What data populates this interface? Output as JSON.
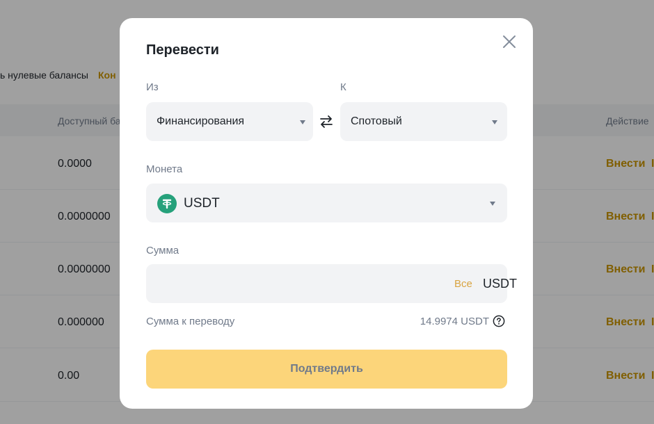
{
  "background": {
    "filter_text": "ь нулевые балансы",
    "filter_link": "Кон",
    "header": {
      "available": "Доступный ба",
      "action": "Действие"
    },
    "rows": [
      {
        "value": "0.0000",
        "action": "Внести",
        "sep": "I"
      },
      {
        "value": "0.0000000",
        "action": "Внести",
        "sep": "I"
      },
      {
        "value": "0.0000000",
        "action": "Внести",
        "sep": "I"
      },
      {
        "value": "0.000000",
        "action": "Внести",
        "sep": "I"
      },
      {
        "value": "0.00",
        "action": "Внести",
        "sep": "I"
      }
    ]
  },
  "modal": {
    "title": "Перевести",
    "close_icon": "close-icon",
    "from": {
      "label": "Из",
      "value": "Финансирования"
    },
    "swap_icon": "swap-arrows-icon",
    "to": {
      "label": "К",
      "value": "Спотовый"
    },
    "coin": {
      "label": "Монета",
      "value": "USDT",
      "icon": "tether-icon",
      "icon_color": "#26a17b"
    },
    "amount": {
      "label": "Сумма",
      "value": "",
      "placeholder": "",
      "all_label": "Все",
      "unit": "USDT"
    },
    "transfer": {
      "label": "Сумма к переводу",
      "value": "14.9974 USDT",
      "help_icon": "question-circle-icon"
    },
    "confirm_label": "Подтвердить"
  },
  "colors": {
    "accent": "#c99400",
    "button": "#fcd57a",
    "field": "#f2f3f5"
  }
}
